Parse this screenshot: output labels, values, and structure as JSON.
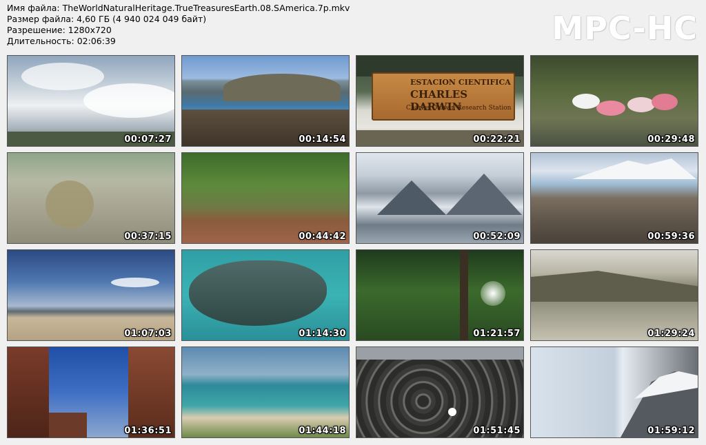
{
  "info": {
    "filename": "Имя файла: TheWorldNaturalHeritage.TrueTreasuresEarth.08.SAmerica.7p.mkv",
    "filesize": "Размер файла: 4,60 ГБ (4 940 024 049 байт)",
    "resolution": "Разрешение: 1280x720",
    "duration": "Длительность: 02:06:39"
  },
  "logo": "MPC-HC",
  "thumbnails": [
    {
      "time": "00:07:27",
      "scene": "cloudy-sky"
    },
    {
      "time": "00:14:54",
      "scene": "volcanic-island-coast"
    },
    {
      "time": "00:22:21",
      "scene": "research-station-sign"
    },
    {
      "time": "00:29:48",
      "scene": "spoonbills-in-water"
    },
    {
      "time": "00:37:15",
      "scene": "dry-shrub-ground"
    },
    {
      "time": "00:44:42",
      "scene": "grass-and-butterflies"
    },
    {
      "time": "00:52:09",
      "scene": "glacier-mountains"
    },
    {
      "time": "00:59:36",
      "scene": "rocky-shore-glacier"
    },
    {
      "time": "01:07:03",
      "scene": "beach-with-birds"
    },
    {
      "time": "01:14:30",
      "scene": "underwater-fish"
    },
    {
      "time": "01:21:57",
      "scene": "forest-sunlight"
    },
    {
      "time": "01:29:24",
      "scene": "misty-hills"
    },
    {
      "time": "01:36:51",
      "scene": "red-rock-canyon"
    },
    {
      "time": "01:44:18",
      "scene": "turquoise-lagoon"
    },
    {
      "time": "01:51:45",
      "scene": "tidal-stromatolites"
    },
    {
      "time": "01:59:12",
      "scene": "ice-wall-mountain"
    }
  ],
  "sign": {
    "line1": "ESTACION CIENTIFICA",
    "line2": "CHARLES DARWIN",
    "line3": "Charles Darwin Research Station"
  },
  "colors": {
    "background": "#f0f0f0",
    "timestamp": "#ffffff"
  }
}
